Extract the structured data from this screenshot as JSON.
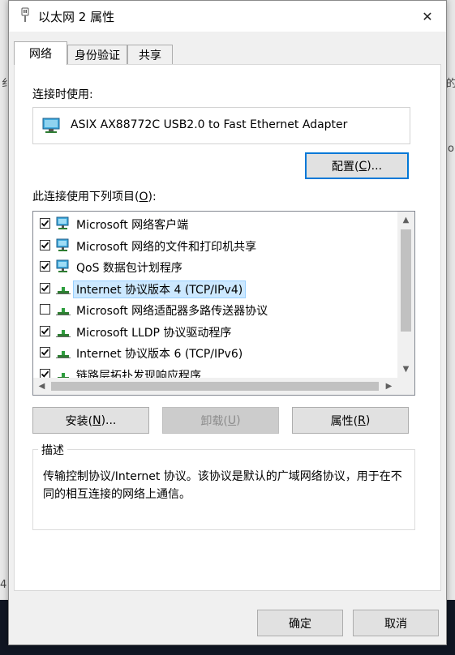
{
  "window": {
    "title": "以太网 2 属性",
    "close_symbol": "✕"
  },
  "tabs": [
    {
      "label": "网络",
      "active": true
    },
    {
      "label": "身份验证",
      "active": false
    },
    {
      "label": "共享",
      "active": false
    }
  ],
  "connect_using": {
    "label": "连接时使用:",
    "adapter_name": "ASIX AX88772C USB2.0 to Fast Ethernet Adapter",
    "adapter_icon": "network-adapter-icon",
    "configure_button": {
      "text": "配置(",
      "mnemonic": "C",
      "suffix": ")..."
    }
  },
  "items_section": {
    "label_text": "此连接使用下列项目(",
    "label_mnemonic": "O",
    "label_suffix": "):",
    "items": [
      {
        "label": "Microsoft 网络客户端",
        "checked": true,
        "icon": "network-client-icon",
        "selected": false
      },
      {
        "label": "Microsoft 网络的文件和打印机共享",
        "checked": true,
        "icon": "network-client-icon",
        "selected": false
      },
      {
        "label": "QoS 数据包计划程序",
        "checked": true,
        "icon": "network-client-icon",
        "selected": false
      },
      {
        "label": "Internet 协议版本 4 (TCP/IPv4)",
        "checked": true,
        "icon": "protocol-icon",
        "selected": true
      },
      {
        "label": "Microsoft 网络适配器多路传送器协议",
        "checked": false,
        "icon": "protocol-icon",
        "selected": false
      },
      {
        "label": "Microsoft LLDP 协议驱动程序",
        "checked": true,
        "icon": "protocol-icon",
        "selected": false
      },
      {
        "label": "Internet 协议版本 6 (TCP/IPv6)",
        "checked": true,
        "icon": "protocol-icon",
        "selected": false
      },
      {
        "label": "链路层拓扑发现响应程序",
        "checked": true,
        "icon": "protocol-icon",
        "selected": false
      }
    ]
  },
  "action_buttons": {
    "install": {
      "text": "安装(",
      "mnemonic": "N",
      "suffix": ")..."
    },
    "uninstall": {
      "text": "卸载(",
      "mnemonic": "U",
      "suffix": ")"
    },
    "properties": {
      "text": "属性(",
      "mnemonic": "R",
      "suffix": ")"
    }
  },
  "description": {
    "legend": "描述",
    "text": "传输控制协议/Internet 协议。该协议是默认的广域网络协议，用于在不同的相互连接的网络上通信。"
  },
  "footer": {
    "ok": "确定",
    "cancel": "取消"
  },
  "background_fragments": {
    "left_top": "纟",
    "left_bottom": "4",
    "right_top": "的",
    "right_mid": "o"
  },
  "colors": {
    "accent": "#0078d7",
    "selection": "#cce8ff",
    "taskbar": "#101623"
  }
}
